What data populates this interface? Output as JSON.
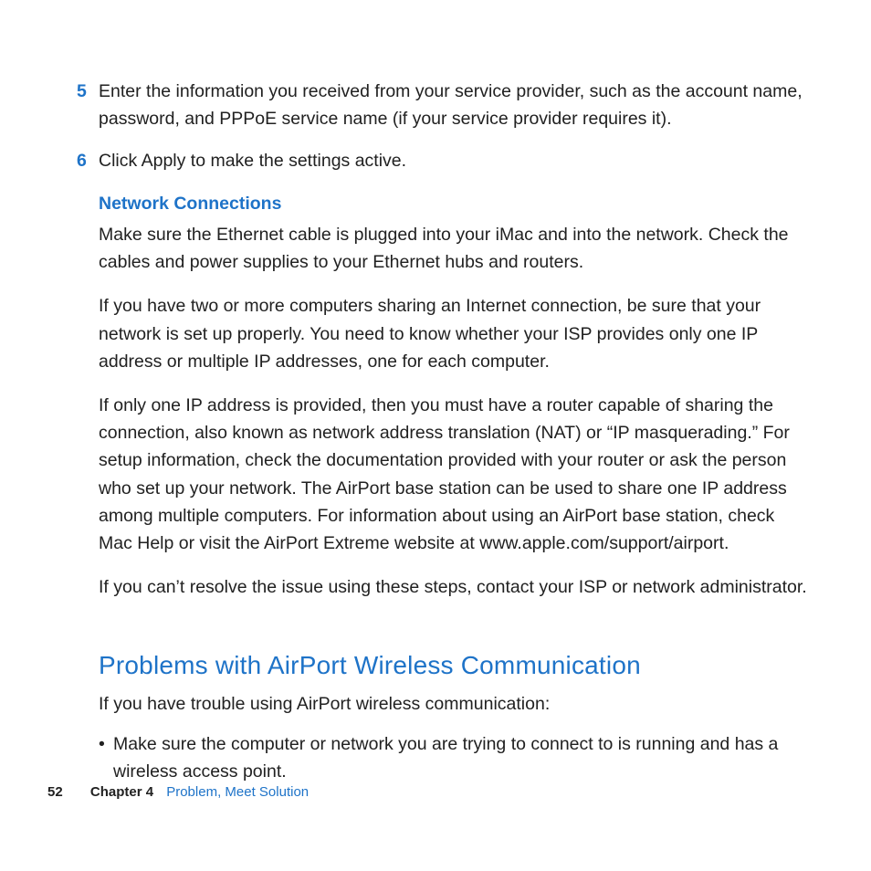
{
  "steps": [
    {
      "num": "5",
      "text": "Enter the information you received from your service provider, such as the account name, password, and PPPoE service name (if your service provider requires it)."
    },
    {
      "num": "6",
      "text": "Click Apply to make the settings active."
    }
  ],
  "network_section": {
    "title": "Network Connections",
    "paras": [
      "Make sure the Ethernet cable is plugged into your iMac and into the network. Check the cables and power supplies to your Ethernet hubs and routers.",
      "If you have two or more computers sharing an Internet connection, be sure that your network is set up properly. You need to know whether your ISP provides only one IP address or multiple IP addresses, one for each computer.",
      "If only one IP address is provided, then you must have a router capable of sharing the connection, also known as network address translation (NAT) or “IP masquerading.” For setup information, check the documentation provided with your router or ask the person who set up your network. The AirPort base station can be used to share one IP address among multiple computers. For information about using an AirPort base station, check Mac Help or visit the AirPort Extreme website at www.apple.com/support/airport.",
      "If you can’t resolve the issue using these steps, contact your ISP or network administrator."
    ]
  },
  "airport_section": {
    "heading": "Problems with AirPort Wireless Communication",
    "intro": "If you have trouble using AirPort wireless communication:",
    "bullets": [
      "Make sure the computer or network you are trying to connect to is running and has a wireless access point."
    ]
  },
  "footer": {
    "page": "52",
    "chapter_label": "Chapter 4",
    "chapter_title": "Problem, Meet Solution"
  }
}
